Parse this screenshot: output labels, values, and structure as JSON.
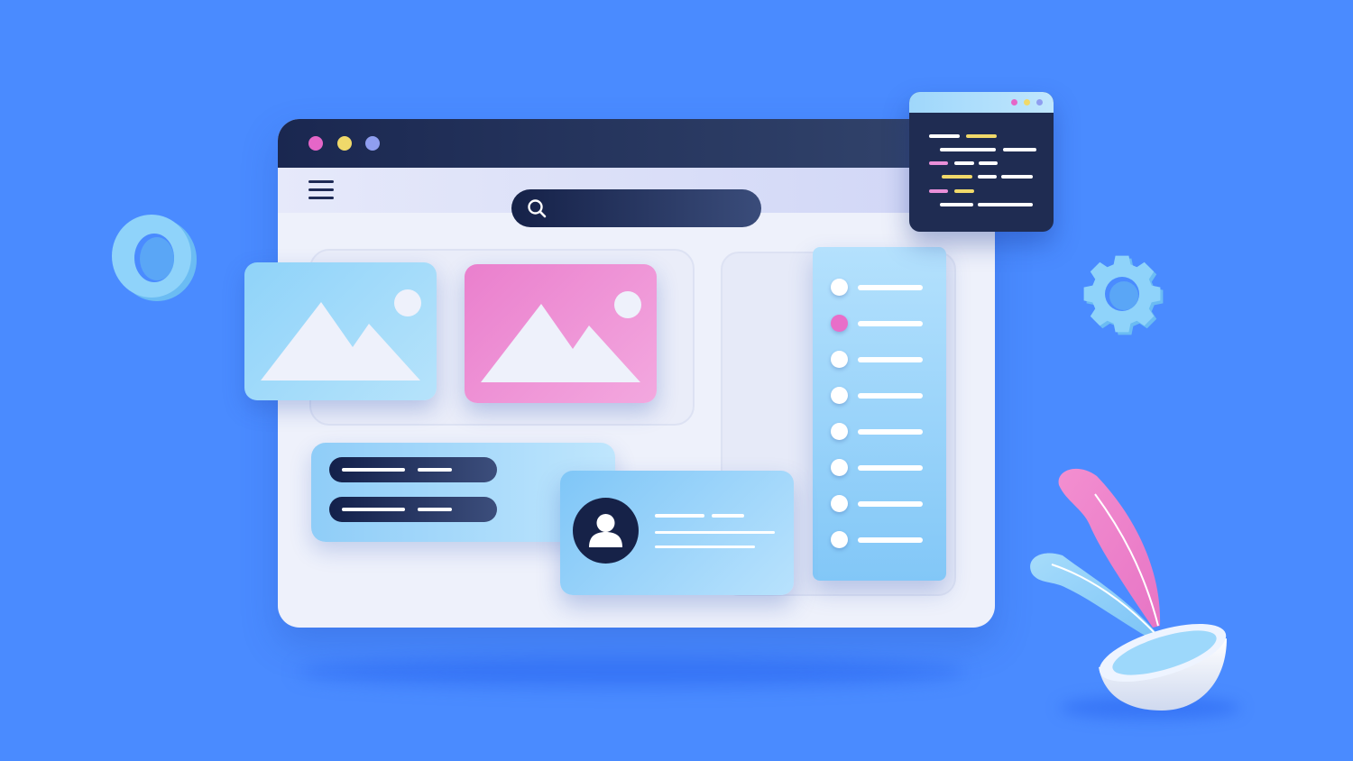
{
  "colors": {
    "background": "#4a8bff",
    "titlebar_start": "#1a2750",
    "titlebar_end": "#34466e",
    "window_body": "#eef1fb",
    "dot_pink": "#e566c8",
    "dot_yellow": "#f0d96a",
    "dot_purple": "#8f9ef0",
    "list_dot_active": "#e86ec9",
    "code_white": "#ffffff",
    "code_yellow": "#f0d96a",
    "code_pink": "#e98fd8"
  },
  "icons": {
    "menu": "hamburger-icon",
    "search": "search-icon",
    "image": "image-icon",
    "user": "user-icon",
    "gear": "gear-icon",
    "ring": "ring-shape",
    "plant": "plant-icon"
  },
  "search": {
    "placeholder": ""
  },
  "list": {
    "item_count": 8,
    "active_index": 1
  }
}
